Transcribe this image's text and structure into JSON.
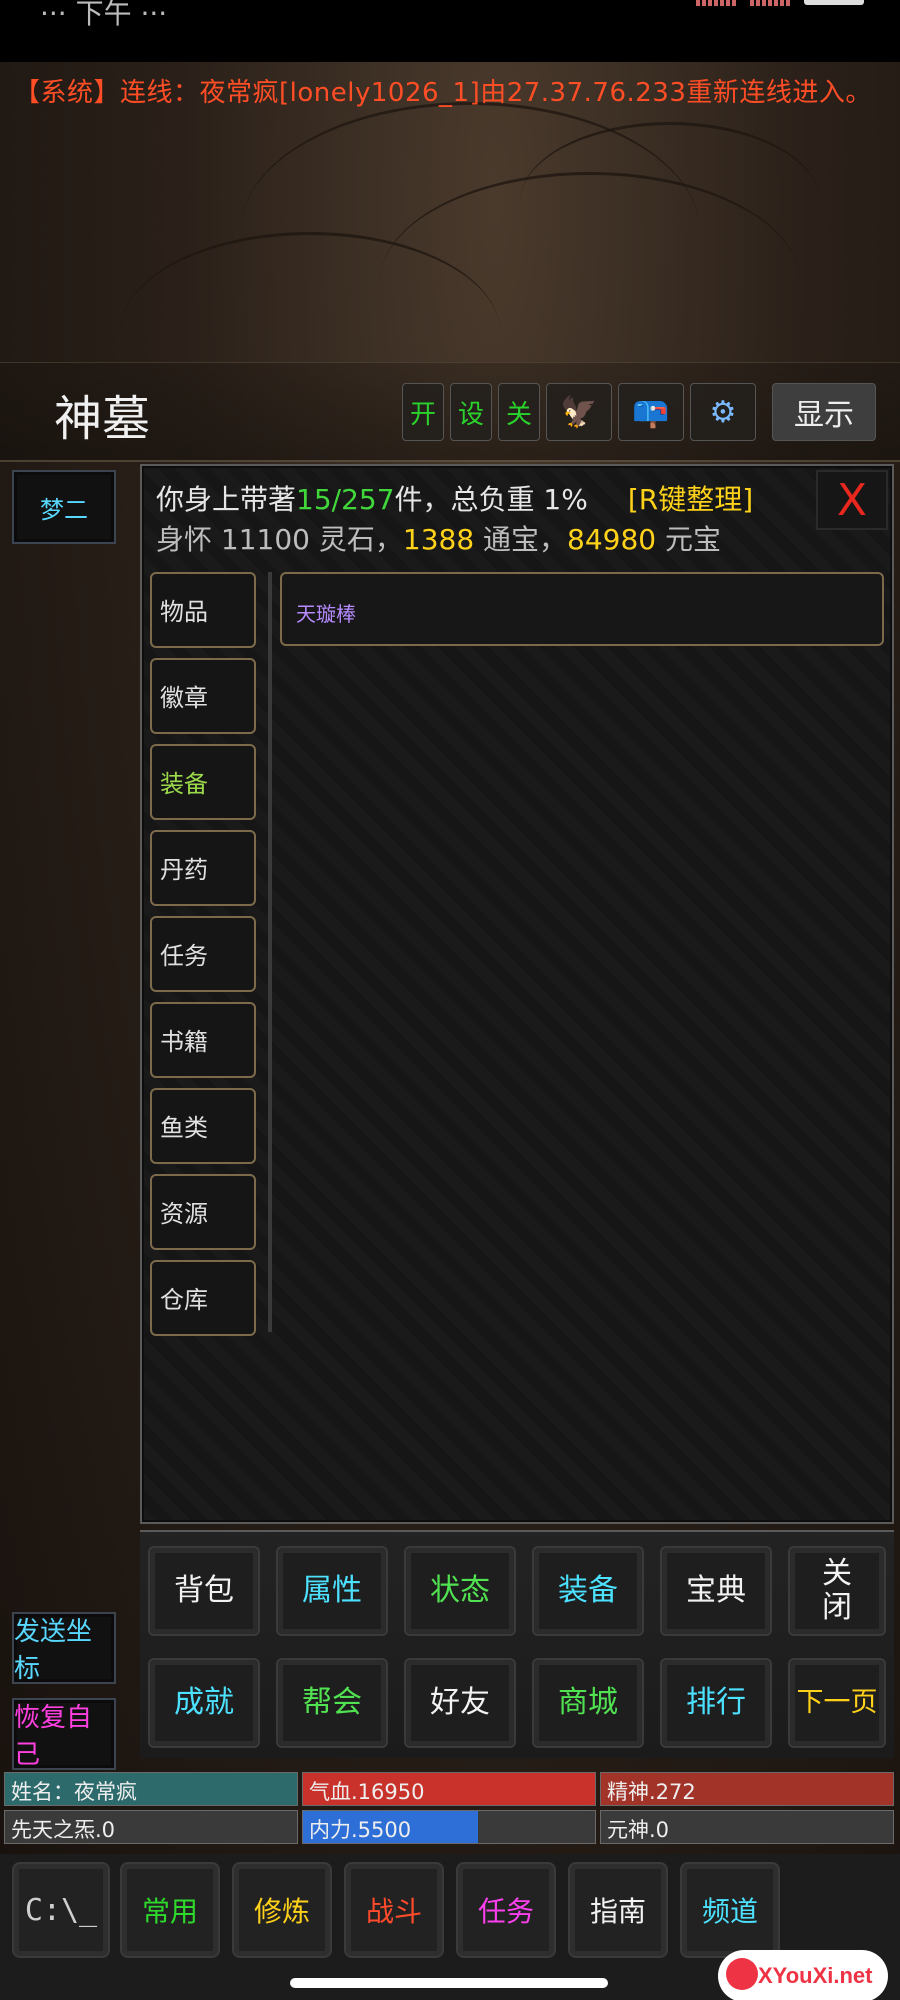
{
  "status_bar": {
    "left_text": "··· 下午 ···",
    "right_text": ""
  },
  "system_message": "【系统】连线：夜常疯[lonely1026_1]由27.37.76.233重新连线进入。",
  "map_bar": {
    "map_name": "神墓",
    "buttons": [
      "开",
      "设",
      "关"
    ],
    "icon_buttons": [
      "eagle-icon",
      "mailbox-icon",
      "gear-icon"
    ],
    "show_label": "显示"
  },
  "side": {
    "partner": "梦二",
    "send_coords": "发送坐标",
    "restore_self": "恢复自己"
  },
  "inventory": {
    "line1_prefix": "你身上带著",
    "count": "15/257",
    "line1_suffix": "件，总负重 1%",
    "sort_label": "[R键整理]",
    "line2_a": "身怀 11100 灵石，",
    "tongbao": "1388",
    "line2_b": " 通宝，",
    "yuanbao": "84980",
    "line2_c": " 元宝",
    "close_label": "X",
    "categories": [
      "物品",
      "徽章",
      "装备",
      "丹药",
      "任务",
      "书籍",
      "鱼类",
      "资源",
      "仓库"
    ],
    "active_category": "装备",
    "items": [
      "天璇棒"
    ]
  },
  "func_buttons": {
    "row1": [
      "背包",
      "属性",
      "状态",
      "装备",
      "宝典",
      "关闭"
    ],
    "row2": [
      "成就",
      "帮会",
      "好友",
      "商城",
      "排行",
      "下一页"
    ]
  },
  "stats": {
    "name": "姓名：夜常疯",
    "qixue": "气血.16950",
    "jingshen": "精神.272",
    "xiantian": "先天之炁.0",
    "neili": "内力.5500",
    "yuanshen": "元神.0",
    "neili_fill": 0.6
  },
  "bottom_bar": {
    "cmd_label": "C:\\_",
    "buttons": [
      "常用",
      "修炼",
      "战斗",
      "任务",
      "指南",
      "频道"
    ],
    "watermark": "XYouXi.net"
  }
}
